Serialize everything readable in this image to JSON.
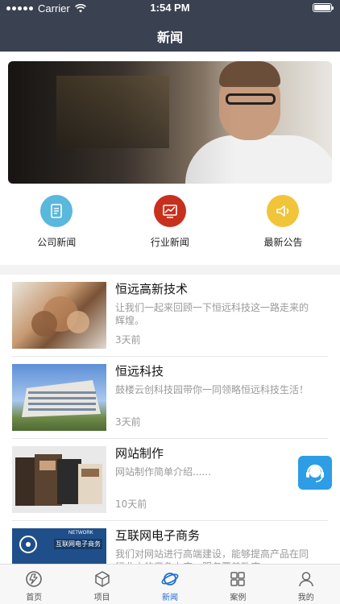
{
  "status_bar": {
    "carrier": "Carrier",
    "time": "1:54 PM"
  },
  "header": {
    "title": "新闻"
  },
  "categories": [
    {
      "label": "公司新闻",
      "icon": "document-icon",
      "color": "#5ab7dd"
    },
    {
      "label": "行业新闻",
      "icon": "chart-icon",
      "color": "#c8301e"
    },
    {
      "label": "最新公告",
      "icon": "megaphone-icon",
      "color": "#f1c43a"
    }
  ],
  "news": [
    {
      "title": "恒远高新技术",
      "summary": "让我们一起来回顾一下恒远科技这一路走来的辉煌。",
      "time": "3天前"
    },
    {
      "title": "恒远科技",
      "summary": "鼓楼云创科技园带你一同领略恒远科技生活！",
      "time": "3天前"
    },
    {
      "title": "网站制作",
      "summary": "网站制作简单介绍......",
      "time": "10天前"
    },
    {
      "title": "互联网电子商务",
      "summary": "我们对网站进行高端建设，能够提高产品在同行业内的竞争力度，服务覆盖政府",
      "time": "",
      "thumb_text": [
        "NETWORK",
        "互联网电子商务"
      ]
    }
  ],
  "tabbar": [
    {
      "label": "首页",
      "icon": "home-icon",
      "active": false
    },
    {
      "label": "项目",
      "icon": "box-icon",
      "active": false
    },
    {
      "label": "新闻",
      "icon": "planet-icon",
      "active": true
    },
    {
      "label": "案例",
      "icon": "grid-icon",
      "active": false
    },
    {
      "label": "我的",
      "icon": "user-icon",
      "active": false
    }
  ],
  "colors": {
    "header_bg": "#3a4151",
    "accent": "#1f6fd1",
    "service_bg": "#2d9de6"
  }
}
